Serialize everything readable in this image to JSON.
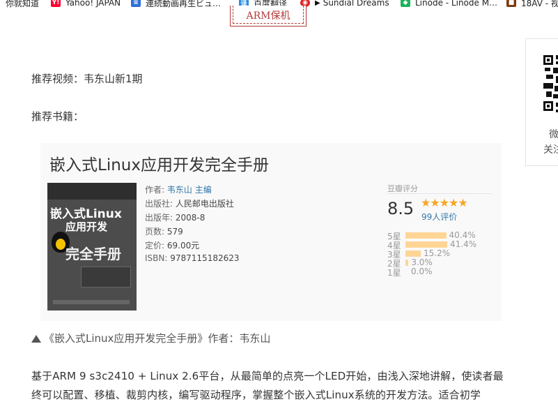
{
  "bookmarks": [
    {
      "label": "你就知道",
      "icon": "none"
    },
    {
      "label": "Yahoo! JAPAN",
      "icon": "yahoo-icon"
    },
    {
      "label": "連続動画再生ビュ…",
      "icon": "document-icon"
    },
    {
      "label": "百度翻译",
      "icon": "translate-icon"
    },
    {
      "label": "Sundial Dreams",
      "icon": "play-icon"
    },
    {
      "label": "Linode - Linode M…",
      "icon": "linode-icon"
    },
    {
      "label": "18AV - 视",
      "icon": "site-icon"
    }
  ],
  "tag_button": {
    "label": "ARM保机"
  },
  "side_panel": {
    "line1": "微",
    "line2": "关注"
  },
  "article": {
    "recommend_video": "推荐视频：韦东山新1期",
    "recommend_books": "推荐书籍："
  },
  "book_card": {
    "title": "嵌入式Linux应用开发完全手册",
    "cover": {
      "line1": "嵌入式Linux",
      "line2": "应用开发",
      "line3": "完全手册"
    },
    "author_label": "作者:",
    "author": "韦东山 主编",
    "publisher_label": "出版社:",
    "publisher": "人民邮电出版社",
    "year_label": "出版年:",
    "year": "2008-8",
    "pages_label": "页数:",
    "pages": "579",
    "price_label": "定价:",
    "price": "69.00元",
    "isbn_label": "ISBN:",
    "isbn": "9787115182623",
    "rating_label": "豆瓣评分",
    "score": "8.5",
    "stars": "★★★★★",
    "star_fraction": 0.85,
    "rating_count": "99人评价",
    "distribution": [
      {
        "label": "5星",
        "percent": "40.4%",
        "value": 40.4
      },
      {
        "label": "4星",
        "percent": "41.4%",
        "value": 41.4
      },
      {
        "label": "3星",
        "percent": "15.2%",
        "value": 15.2
      },
      {
        "label": "2星",
        "percent": "3.0%",
        "value": 3.0
      },
      {
        "label": "1星",
        "percent": "0.0%",
        "value": 0.0
      }
    ]
  },
  "caption": "《嵌入式Linux应用开发完全手册》作者：韦东山",
  "body": {
    "line1": "基于ARM 9 s3c2410 + Linux 2.6平台，从最简单的点亮一个LED开始，由浅入深地讲解，使读者最",
    "line2": "终可以配置、移植、裁剪内核，编写驱动程序，掌握整个嵌入式Linux系统的开发方法。适合初学"
  },
  "colors": {
    "accent_red": "#b23a3a",
    "link_blue": "#3377aa",
    "star_orange": "#f5a623",
    "bar_fill": "#ffd596"
  }
}
